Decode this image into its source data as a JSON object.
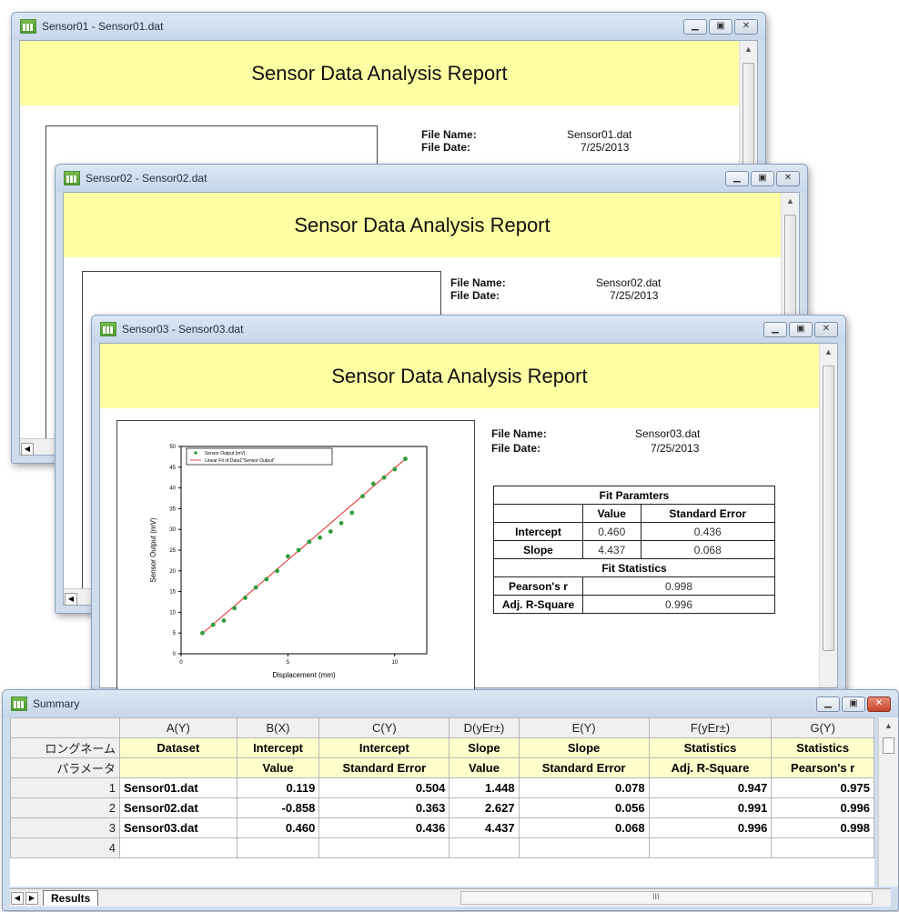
{
  "windows": [
    {
      "title": "Sensor01 - Sensor01.dat",
      "file_name": "Sensor01.dat",
      "file_date": "7/25/2013"
    },
    {
      "title": "Sensor02 - Sensor02.dat",
      "file_name": "Sensor02.dat",
      "file_date": "7/25/2013"
    },
    {
      "title": "Sensor03 - Sensor03.dat",
      "file_name": "Sensor03.dat",
      "file_date": "7/25/2013"
    }
  ],
  "report_title": "Sensor Data Analysis Report",
  "labels": {
    "file_name": "File Name:",
    "file_date": "File Date:"
  },
  "fit_table": {
    "params_title": "Fit Paramters",
    "col_value": "Value",
    "col_se": "Standard Error",
    "intercept_label": "Intercept",
    "intercept_value": "0.460",
    "intercept_se": "0.436",
    "slope_label": "Slope",
    "slope_value": "4.437",
    "slope_se": "0.068",
    "stats_title": "Fit Statistics",
    "pearson_label": "Pearson's r",
    "pearson_value": "0.998",
    "adjr_label": "Adj. R-Square",
    "adjr_value": "0.996"
  },
  "chart_data": {
    "type": "scatter",
    "xlabel": "Displacement (mm)",
    "ylabel": "Sensor Output (mV)",
    "xlim": [
      0,
      11.5
    ],
    "ylim": [
      0,
      50
    ],
    "xticks": [
      "0",
      "5",
      "10"
    ],
    "yticks": [
      "0",
      "5",
      "10",
      "15",
      "20",
      "25",
      "30",
      "35",
      "40",
      "45",
      "50"
    ],
    "legend": [
      "Sensor Output (mV)",
      "Linear Fit of Data1\"Sensor Output\""
    ],
    "series": [
      {
        "name": "Sensor Output (mV)",
        "x": [
          1,
          1.5,
          2,
          2.5,
          3,
          3.5,
          4,
          4.5,
          5,
          5.5,
          6,
          6.5,
          7,
          7.5,
          8,
          8.5,
          9,
          9.5,
          10,
          10.5
        ],
        "y": [
          5,
          7,
          8,
          11,
          13.5,
          16,
          18,
          20,
          23.5,
          25,
          27,
          28,
          29.5,
          31.5,
          34,
          38,
          41,
          42.5,
          44.5,
          47
        ]
      },
      {
        "name": "Linear Fit of Data1\"Sensor Output\"",
        "x": [
          1,
          10.5
        ],
        "y": [
          4.9,
          47.0
        ]
      }
    ]
  },
  "summary": {
    "title": "Summary",
    "col_letters": [
      "A(Y)",
      "B(X)",
      "C(Y)",
      "D(yEr±)",
      "E(Y)",
      "F(yEr±)",
      "G(Y)"
    ],
    "long_name_label": "ロングネーム",
    "param_label": "パラメータ",
    "long_names": [
      "Dataset",
      "Intercept",
      "Intercept",
      "Slope",
      "Slope",
      "Statistics",
      "Statistics"
    ],
    "params": [
      "",
      "Value",
      "Standard Error",
      "Value",
      "Standard Error",
      "Adj. R-Square",
      "Pearson's r"
    ],
    "rows": [
      {
        "n": "1",
        "cells": [
          "Sensor01.dat",
          "0.119",
          "0.504",
          "1.448",
          "0.078",
          "0.947",
          "0.975"
        ]
      },
      {
        "n": "2",
        "cells": [
          "Sensor02.dat",
          "-0.858",
          "0.363",
          "2.627",
          "0.056",
          "0.991",
          "0.996"
        ]
      },
      {
        "n": "3",
        "cells": [
          "Sensor03.dat",
          "0.460",
          "0.436",
          "4.437",
          "0.068",
          "0.996",
          "0.998"
        ]
      },
      {
        "n": "4",
        "cells": [
          "",
          "",
          "",
          "",
          "",
          "",
          ""
        ]
      }
    ],
    "sheet_tab": "Results",
    "hscroll_mark": "III"
  },
  "window_controls": {
    "minimize": "▁",
    "maximize": "▣",
    "close": "✕"
  },
  "colors": {
    "band": "#fefea3",
    "header_yellow": "#ffffcc",
    "fit_line": "#e84a4a",
    "points": "#2f9e3a"
  }
}
